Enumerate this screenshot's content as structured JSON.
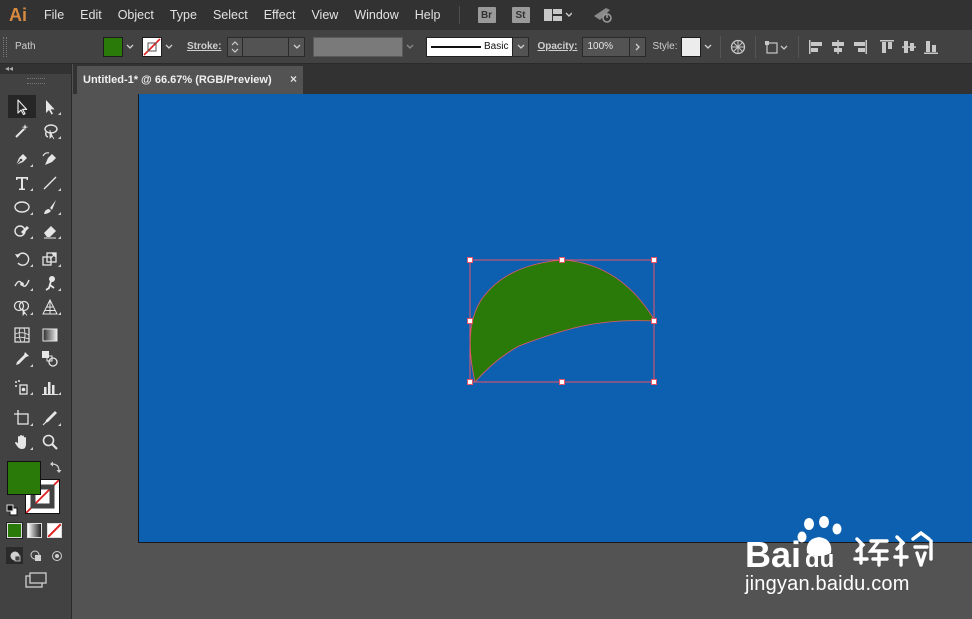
{
  "app": {
    "logo": "Ai"
  },
  "menu": [
    "File",
    "Edit",
    "Object",
    "Type",
    "Select",
    "Effect",
    "View",
    "Window",
    "Help"
  ],
  "app_buttons": {
    "bridge": "Br",
    "stock": "St"
  },
  "controlbar": {
    "selection_label": "Path",
    "fill_color": "#2a7a0a",
    "stroke_label": "Stroke:",
    "brush_label": "Basic",
    "opacity_label": "Opacity:",
    "opacity_value": "100%",
    "style_label": "Style:"
  },
  "document": {
    "tab_title": "Untitled-1* @ 66.67% (RGB/Preview)",
    "close_glyph": "×"
  },
  "colors": {
    "artboard": "#0c60af",
    "shape_fill": "#2a7a0a",
    "selection": "#e8546a",
    "panel": "#424242",
    "menubar": "#323232"
  },
  "tools": [
    [
      "selection-tool",
      "direct-selection-tool"
    ],
    [
      "magic-wand-tool",
      "lasso-tool"
    ],
    [
      "pen-tool",
      "curvature-tool"
    ],
    [
      "type-tool",
      "line-segment-tool"
    ],
    [
      "ellipse-tool",
      "paintbrush-tool"
    ],
    [
      "shaper-tool",
      "eraser-tool"
    ],
    [
      "rotate-tool",
      "scale-tool"
    ],
    [
      "width-tool",
      "puppet-warp-tool"
    ],
    [
      "shape-builder-tool",
      "perspective-grid-tool"
    ],
    [
      "mesh-tool",
      "gradient-tool"
    ],
    [
      "eyedropper-tool",
      "blend-tool"
    ],
    [
      "symbol-sprayer-tool",
      "column-graph-tool"
    ],
    [
      "artboard-tool",
      "slice-tool"
    ],
    [
      "hand-tool",
      "zoom-tool"
    ]
  ],
  "watermark": {
    "url": "jingyan.baidu.com"
  }
}
